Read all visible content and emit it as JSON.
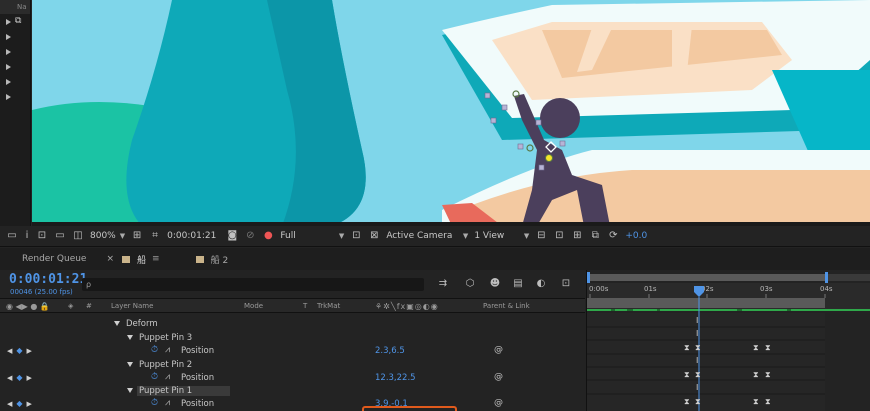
{
  "project_panel": {
    "header": "Na",
    "rows": 6
  },
  "viewer_toolbar": {
    "zoom": "800%",
    "timecode": "0:00:01:21",
    "resolution": "Full",
    "camera": "Active Camera",
    "views": "1 View",
    "exposure": "+0.0"
  },
  "tabs": [
    {
      "label": "Render Queue"
    },
    {
      "label": "船",
      "active": true,
      "color": "#c9b38a"
    },
    {
      "label": "船 2",
      "color": "#c9b38a"
    }
  ],
  "timeline": {
    "timecode": "0:00:01:21",
    "frames": "00046 (25.00 fps)",
    "search_icon": "ρ",
    "columns": {
      "hash": "#",
      "layer_name": "Layer Name",
      "mode": "Mode",
      "t": "T",
      "trkmat": "TrkMat",
      "parent": "Parent & Link"
    },
    "ruler": [
      "0:00s",
      "01s",
      "02s",
      "03s",
      "04s"
    ]
  },
  "layers": [
    {
      "label": "Deform"
    },
    {
      "label": "Puppet Pin 3"
    },
    {
      "label": "Position",
      "value": "2.3,6.5"
    },
    {
      "label": "Puppet Pin 2"
    },
    {
      "label": "Position",
      "value": "12.3,22.5"
    },
    {
      "label": "Puppet Pin 1"
    },
    {
      "label": "Position",
      "value": "3.9,-0.1"
    }
  ],
  "colors": {
    "accent": "#4f94e6",
    "sky": "#7fd6ea",
    "highlight": "#e05a1c"
  }
}
